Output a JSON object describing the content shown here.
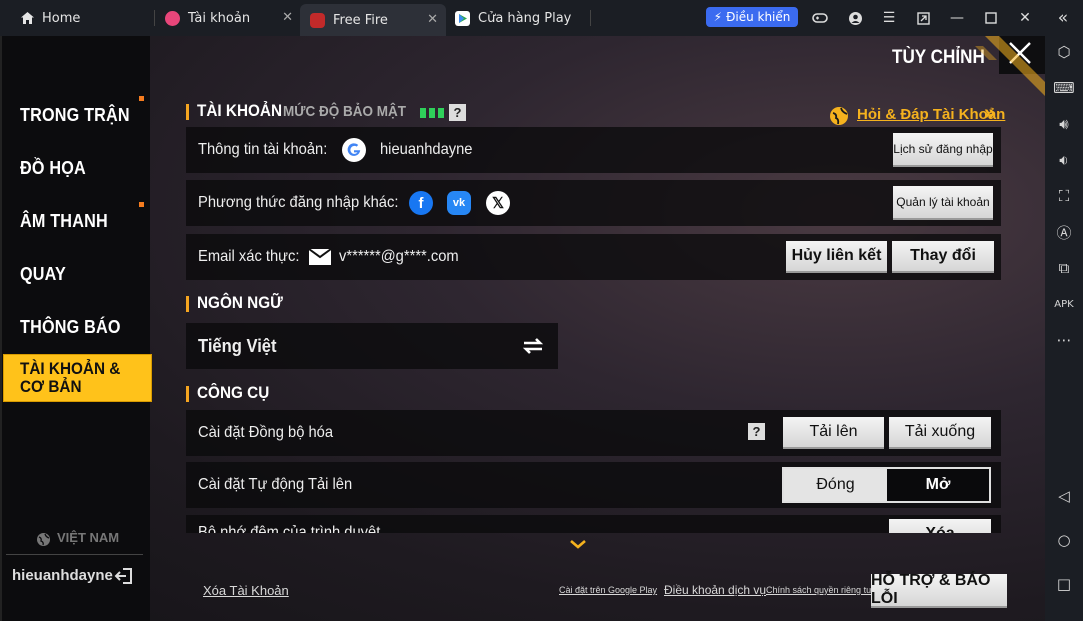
{
  "tabs": [
    {
      "label": "Home",
      "icon": "home-icon"
    },
    {
      "label": "Tài khoản",
      "icon": "account-app-icon"
    },
    {
      "label": "Free Fire",
      "icon": "free-fire-app-icon"
    },
    {
      "label": "Cửa hàng Play",
      "icon": "play-store-icon"
    }
  ],
  "window_controls": {
    "dieukhien_label": "Điều khiển",
    "icons": [
      "gamepad-icon",
      "account-circle-icon",
      "menu-icon",
      "restore-icon",
      "minimize-icon",
      "maximize-icon",
      "close-icon",
      "collapse-sidebar-icon"
    ]
  },
  "right_toolbar": [
    "settings-hex-icon",
    "keyboard-icon",
    "volume-up-icon",
    "volume-down-icon",
    "screen-size-icon",
    "auto-translate-icon",
    "multi-instance-icon",
    "apk-install-icon",
    "more-icon",
    "back-icon",
    "home-circle-icon",
    "recents-icon"
  ],
  "nav": {
    "items": [
      "TRONG TRẬN",
      "ĐỒ HỌA",
      "ÂM THANH",
      "QUAY",
      "THÔNG BÁO"
    ],
    "active": "TÀI KHOẢN & CƠ BẢN",
    "region": "VIỆT NAM",
    "username": "hieuanhdayne"
  },
  "header": {
    "title": "TÙY CHỈNH"
  },
  "account": {
    "title": "TÀI KHOẢN",
    "security_label": "MỨC ĐỘ BẢO MẬT",
    "security_level": 3,
    "faq_link": "Hỏi & Đáp Tài Khoản",
    "info_label": "Thông tin tài khoản:",
    "info_value": "hieuanhdayne",
    "login_history": "Lịch sử đăng nhập",
    "other_login_label": "Phương thức đăng nhập khác:",
    "manage_accounts": "Quản lý tài khoản",
    "email_label": "Email xác thực:",
    "email_value": "v******@g****.com",
    "unlink": "Hủy liên kết",
    "change": "Thay đổi"
  },
  "language": {
    "title": "NGÔN NGỮ",
    "value": "Tiếng Việt"
  },
  "tools": {
    "title": "CÔNG CỤ",
    "sync_label": "Cài đặt Đồng bộ hóa",
    "upload": "Tải lên",
    "download": "Tải xuống",
    "auto_upload_label": "Cài đặt Tự động Tải lên",
    "off": "Đóng",
    "on": "Mở",
    "partial_row": "Bộ nhớ đệm của trình duyệt",
    "partial_button": "Xóa"
  },
  "footer": {
    "delete_account": "Xóa Tài Khoản",
    "google_play_settings": "Cài đặt trên Google Play",
    "terms": "Điều khoản dịch vụ",
    "privacy": "Chính sách quyền riêng tư",
    "support": "HỖ TRỢ & BÁO LỖI"
  }
}
